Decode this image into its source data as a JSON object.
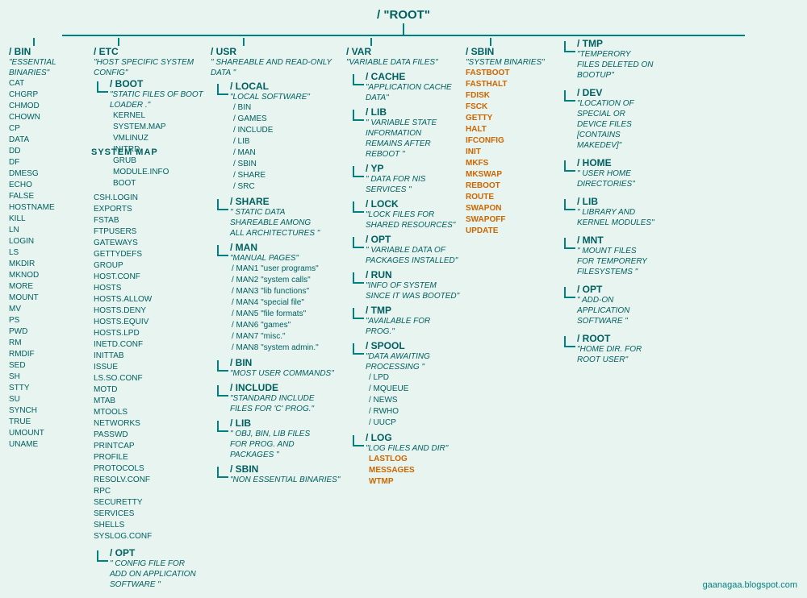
{
  "root": {
    "label": "/   \"ROOT\""
  },
  "bin": {
    "name": "/ BIN",
    "desc": "\"ESSENTIAL BINARIES\"",
    "files": [
      "CAT",
      "CHGRP",
      "CHMOD",
      "CHOWN",
      "CP",
      "DATA",
      "DD",
      "DF",
      "DMESG",
      "ECHO",
      "FALSE",
      "HOSTNAME",
      "KILL",
      "LN",
      "LOGIN",
      "LS",
      "MKDIR",
      "MKNOD",
      "MORE",
      "MOUNT",
      "MV",
      "PS",
      "PWD",
      "RM",
      "RMDIF",
      "SED",
      "SH",
      "STTY",
      "SU",
      "SYNCH",
      "TRUE",
      "UMOUNT",
      "UNAME"
    ]
  },
  "etc": {
    "name": "/ ETC",
    "desc": "\"HOST SPECIFIC SYSTEM CONFIG\"",
    "files": [
      "CSH.LOGIN",
      "EXPORTS",
      "FSTAB",
      "FTPUSERS",
      "GATEWAYS",
      "GETTYDEFS",
      "GROUP",
      "HOST.CONF",
      "HOSTS",
      "HOSTS.ALLOW",
      "HOSTS.DENY",
      "HOSTS.EQUIV",
      "HOSTS.LPD",
      "INETD.CONF",
      "INITTAB",
      "ISSUE",
      "LS.SO.CONF",
      "MOTD",
      "MTAB",
      "MTOOLS",
      "NETWORKS",
      "PASSWD",
      "PRINTCAP",
      "PROFILE",
      "PROTOCOLS",
      "RESOLV.CONF",
      "RPC",
      "SECURETTY",
      "SERVICES",
      "SHELLS",
      "SYSLOG.CONF"
    ],
    "opt": {
      "name": "/ OPT",
      "desc": "\" CONFIG FILE FOR ADD ON APPLICATION SOFTWARE \""
    }
  },
  "boot": {
    "name": "/ BOOT",
    "desc": "\"STATIC FILES OF BOOT LOADER .\"",
    "files": [
      "KERNEL",
      "SYSTEM.MAP",
      "VMLINUZ",
      "INITRD",
      "GRUB",
      "MODULE.INFO",
      "BOOT"
    ]
  },
  "usr": {
    "name": "/ USR",
    "desc": "\" SHAREABLE AND READ-ONLY DATA \"",
    "local": {
      "name": "/ LOCAL",
      "desc": "\"LOCAL SOFTWARE\"",
      "subdirs": [
        "/ BIN",
        "/ GAMES",
        "/ INCLUDE",
        "/ LIB",
        "/ MAN",
        "/ SBIN",
        "/ SHARE",
        "/ SRC"
      ]
    },
    "share": {
      "name": "/ SHARE",
      "desc": "\" STATIC DATA SHAREABLE AMONG ALL ARCHITECTURES \""
    },
    "man": {
      "name": "/ MAN",
      "desc": "\"MANUAL PAGES\"",
      "subdirs": [
        "/ MAN1 \"user programs\"",
        "/ MAN2 \"system calls\"",
        "/ MAN3 \"lib functions\"",
        "/ MAN4 \"special file\"",
        "/ MAN5 \"file formats\"",
        "/ MAN6 \"games\"",
        "/ MAN7 \"misc.\"",
        "/ MAN8 \"system admin.\""
      ]
    },
    "bin": {
      "name": "/ BIN",
      "desc": "\"MOST USER COMMANDS\""
    },
    "include": {
      "name": "/ INCLUDE",
      "desc": "\"STANDARD INCLUDE FILES FOR 'C' PROG.\""
    },
    "lib": {
      "name": "/ LIB",
      "desc": "\" OBJ, BIN, LIB FILES FOR PROG. AND PACKAGES \""
    },
    "sbin": {
      "name": "/ SBIN",
      "desc": "\"NON ESSENTIAL BINARIES\""
    }
  },
  "var": {
    "name": "/ VAR",
    "desc": "\"VARIABLE DATA FILES\"",
    "cache": {
      "name": "/ CACHE",
      "desc": "\"APPLICATION CACHE DATA\""
    },
    "lib": {
      "name": "/ LIB",
      "desc": "\" VARIABLE STATE INFORMATION REMAINS AFTER REBOOT \""
    },
    "yp": {
      "name": "/ YP",
      "desc": "\" DATA FOR NIS SERVICES \""
    },
    "lock": {
      "name": "/ LOCK",
      "desc": "\"LOCK FILES FOR SHARED RESOURCES\""
    },
    "opt": {
      "name": "/ OPT",
      "desc": "\" VARIABLE DATA OF PACKAGES INSTALLED\""
    },
    "run": {
      "name": "/ RUN",
      "desc": "\"INFO OF SYSTEM SINCE IT WAS BOOTED\""
    },
    "tmp": {
      "name": "/ TMP",
      "desc": "\"AVAILABLE FOR PROG.\""
    },
    "spool": {
      "name": "/ SPOOL",
      "desc": "\"DATA AWAITING PROCESSING \"",
      "subdirs": [
        "/ LPD",
        "/ MQUEUE",
        "/ NEWS",
        "/ RWHO",
        "/ UUCP"
      ]
    },
    "log": {
      "name": "/ LOG",
      "desc": "\"LOG FILES AND DIR\"",
      "files_highlight": [
        "LASTLOG",
        "MESSAGES",
        "WTMP"
      ]
    }
  },
  "sbin": {
    "name": "/ SBIN",
    "desc": "\"SYSTEM BINARIES\"",
    "files_normal": [],
    "files_highlight": [
      "FASTBOOT",
      "FASTHALT",
      "FDISK",
      "FSCK",
      "GETTY",
      "HALT",
      "IFCONFIG",
      "INIT",
      "MKFS",
      "MKSWAP",
      "REBOOT",
      "ROUTE",
      "SWAPON",
      "SWAPOFF",
      "UPDATE"
    ]
  },
  "right_panel": {
    "tmp": {
      "name": "/ TMP",
      "desc": "\"TEMPERORY FILES DELETED ON BOOTUP\""
    },
    "dev": {
      "name": "/ DEV",
      "desc": "\"LOCATION OF SPECIAL OR DEVICE FILES [CONTAINS MAKEDEV]\""
    },
    "home": {
      "name": "/ HOME",
      "desc": "\" USER HOME DIRECTORIES\""
    },
    "lib": {
      "name": "/ LIB",
      "desc": "\"  LIBRARY AND KERNEL MODULES\""
    },
    "mnt": {
      "name": "/ MNT",
      "desc": "\"  MOUNT FILES FOR TEMPORERY FILESYSTEMS \""
    },
    "opt": {
      "name": "/ OPT",
      "desc": "\" ADD-ON APPLICATION SOFTWARE \""
    },
    "root": {
      "name": "/ ROOT",
      "desc": "\"HOME DIR. FOR ROOT USER\""
    }
  },
  "system_map_label": "SYSTEM MAP",
  "watermark": "gaanagaa.blogspot.com"
}
